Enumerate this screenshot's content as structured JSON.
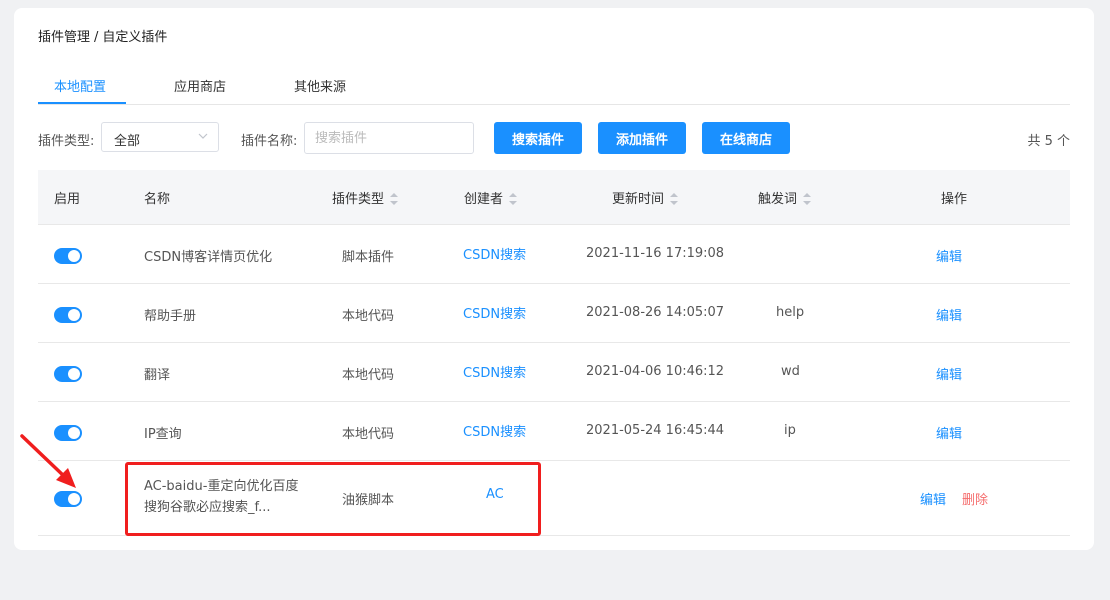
{
  "breadcrumb": {
    "parent": "插件管理",
    "separator": "/",
    "current": "自定义插件"
  },
  "tabs": [
    {
      "label": "本地配置",
      "active": true
    },
    {
      "label": "应用商店",
      "active": false
    },
    {
      "label": "其他来源",
      "active": false
    }
  ],
  "filters": {
    "type_label": "插件类型:",
    "type_value": "全部",
    "name_label": "插件名称:",
    "search_placeholder": "搜索插件",
    "search_value": ""
  },
  "buttons": {
    "search": "搜索插件",
    "add": "添加插件",
    "store": "在线商店"
  },
  "total": "共 5 个",
  "table": {
    "headers": [
      "启用",
      "名称",
      "插件类型",
      "创建者",
      "更新时间",
      "触发词",
      "操作"
    ],
    "rows": [
      {
        "enabled": true,
        "name": "CSDN博客详情页优化",
        "type": "脚本插件",
        "creator": "CSDN搜索",
        "updated": "2021-11-16 17:19:08",
        "trigger": "",
        "actions": [
          "编辑"
        ]
      },
      {
        "enabled": true,
        "name": "帮助手册",
        "type": "本地代码",
        "creator": "CSDN搜索",
        "updated": "2021-08-26 14:05:07",
        "trigger": "help",
        "actions": [
          "编辑"
        ]
      },
      {
        "enabled": true,
        "name": "翻译",
        "type": "本地代码",
        "creator": "CSDN搜索",
        "updated": "2021-04-06 10:46:12",
        "trigger": "wd",
        "actions": [
          "编辑"
        ]
      },
      {
        "enabled": true,
        "name": "IP查询",
        "type": "本地代码",
        "creator": "CSDN搜索",
        "updated": "2021-05-24 16:45:44",
        "trigger": "ip",
        "actions": [
          "编辑"
        ]
      },
      {
        "enabled": true,
        "name": "AC-baidu-重定向优化百度搜狗谷歌必应搜索_f...",
        "type": "油猴脚本",
        "creator": "AC",
        "updated": "",
        "trigger": "",
        "actions": [
          "编辑",
          "删除"
        ]
      }
    ]
  },
  "colors": {
    "accent": "#1a90ff",
    "danger": "#f56c6c",
    "annotation": "#f01e1e"
  }
}
